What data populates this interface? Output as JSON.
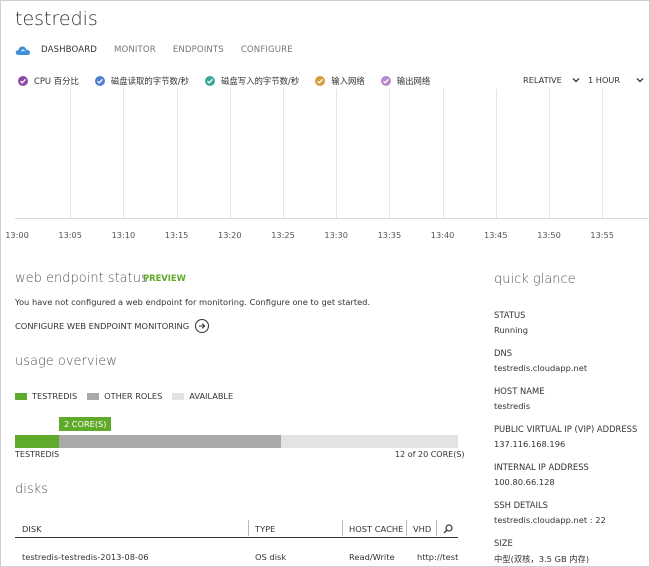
{
  "title": "testredis",
  "nav": {
    "tabs": [
      "DASHBOARD",
      "MONITOR",
      "ENDPOINTS",
      "CONFIGURE"
    ],
    "active": "DASHBOARD"
  },
  "metrics": [
    {
      "label": "CPU 百分比",
      "color": "#8b4aa6"
    },
    {
      "label": "磁盘读取的字节数/秒",
      "color": "#4f7fd1"
    },
    {
      "label": "磁盘写入的字节数/秒",
      "color": "#3aa79f"
    },
    {
      "label": "输入网络",
      "color": "#d99a3a"
    },
    {
      "label": "输出网络",
      "color": "#b889c9"
    }
  ],
  "time_controls": {
    "relative": "RELATIVE",
    "range": "1 HOUR"
  },
  "x_ticks": [
    "13:00",
    "13:05",
    "13:10",
    "13:15",
    "13:20",
    "13:25",
    "13:30",
    "13:35",
    "13:40",
    "13:45",
    "13:50",
    "13:55",
    "14"
  ],
  "web_endpoint": {
    "heading": "web endpoint status",
    "badge": "PREVIEW",
    "message": "You have not configured a web endpoint for monitoring. Configure one to get started.",
    "configure_link": "CONFIGURE WEB ENDPOINT MONITORING"
  },
  "usage": {
    "heading": "usage overview",
    "legend": [
      {
        "label": "TESTREDIS",
        "color": "#5fa92b"
      },
      {
        "label": "OTHER ROLES",
        "color": "#a9a9a9"
      },
      {
        "label": "AVAILABLE",
        "color": "#e3e3e3"
      }
    ],
    "callout": "2 CORE(S)",
    "bar_label": "TESTREDIS",
    "bar_count": "12 of 20 CORE(S)",
    "total_cores": 20,
    "used_cores": 12,
    "testredis_cores": 2
  },
  "disks": {
    "heading": "disks",
    "columns": [
      "DISK",
      "TYPE",
      "HOST CACHE",
      "VHD"
    ],
    "rows": [
      {
        "disk": "testredis-testredis-2013-08-06",
        "type": "OS disk",
        "cache": "Read/Write",
        "vhd": "http://testr"
      }
    ]
  },
  "quick_glance": {
    "heading": "quick glance",
    "items": [
      {
        "label": "STATUS",
        "value": "Running"
      },
      {
        "label": "DNS",
        "value": "testredis.cloudapp.net"
      },
      {
        "label": "HOST NAME",
        "value": "testredis"
      },
      {
        "label": "PUBLIC VIRTUAL IP (VIP) ADDRESS",
        "value": "137.116.168.196"
      },
      {
        "label": "INTERNAL IP ADDRESS",
        "value": "100.80.66.128"
      },
      {
        "label": "SSH DETAILS",
        "value": "testredis.cloudapp.net : 22"
      },
      {
        "label": "SIZE",
        "value": "中型(双核，3.5 GB 内存)"
      }
    ]
  }
}
